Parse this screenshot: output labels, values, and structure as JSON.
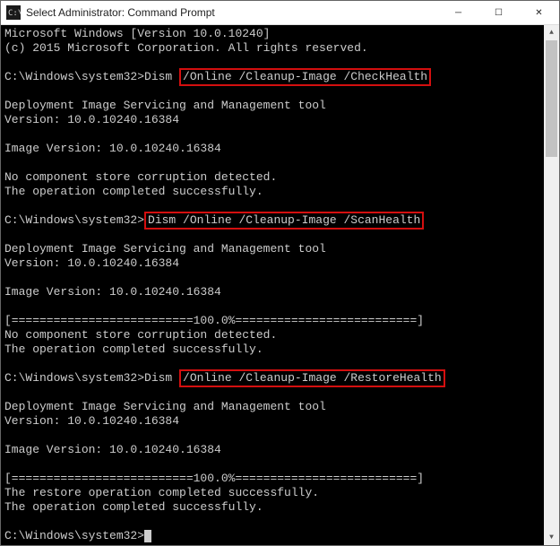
{
  "titlebar": {
    "title": "Select Administrator: Command Prompt"
  },
  "controls": {
    "minimize": "─",
    "maximize": "☐",
    "close": "✕"
  },
  "console": {
    "header1": "Microsoft Windows [Version 10.0.10240]",
    "header2": "(c) 2015 Microsoft Corporation. All rights reserved.",
    "prompt1_path": "C:\\Windows\\system32>",
    "prompt1_cmd_pre": "Dism ",
    "prompt1_cmd_hl": "/Online /Cleanup-Image /CheckHealth",
    "dism_tool": "Deployment Image Servicing and Management tool",
    "dism_ver": "Version: 10.0.10240.16384",
    "image_ver": "Image Version: 10.0.10240.16384",
    "no_corruption": "No component store corruption detected.",
    "op_success": "The operation completed successfully.",
    "prompt2_path": "C:\\Windows\\system32>",
    "prompt2_cmd_hl": "Dism /Online /Cleanup-Image /ScanHealth",
    "progress": "[==========================100.0%==========================]",
    "prompt3_path": "C:\\Windows\\system32>",
    "prompt3_cmd_pre": "Dism ",
    "prompt3_cmd_hl": "/Online /Cleanup-Image /RestoreHealth",
    "restore_success": "The restore operation completed successfully.",
    "prompt4_path": "C:\\Windows\\system32>"
  }
}
